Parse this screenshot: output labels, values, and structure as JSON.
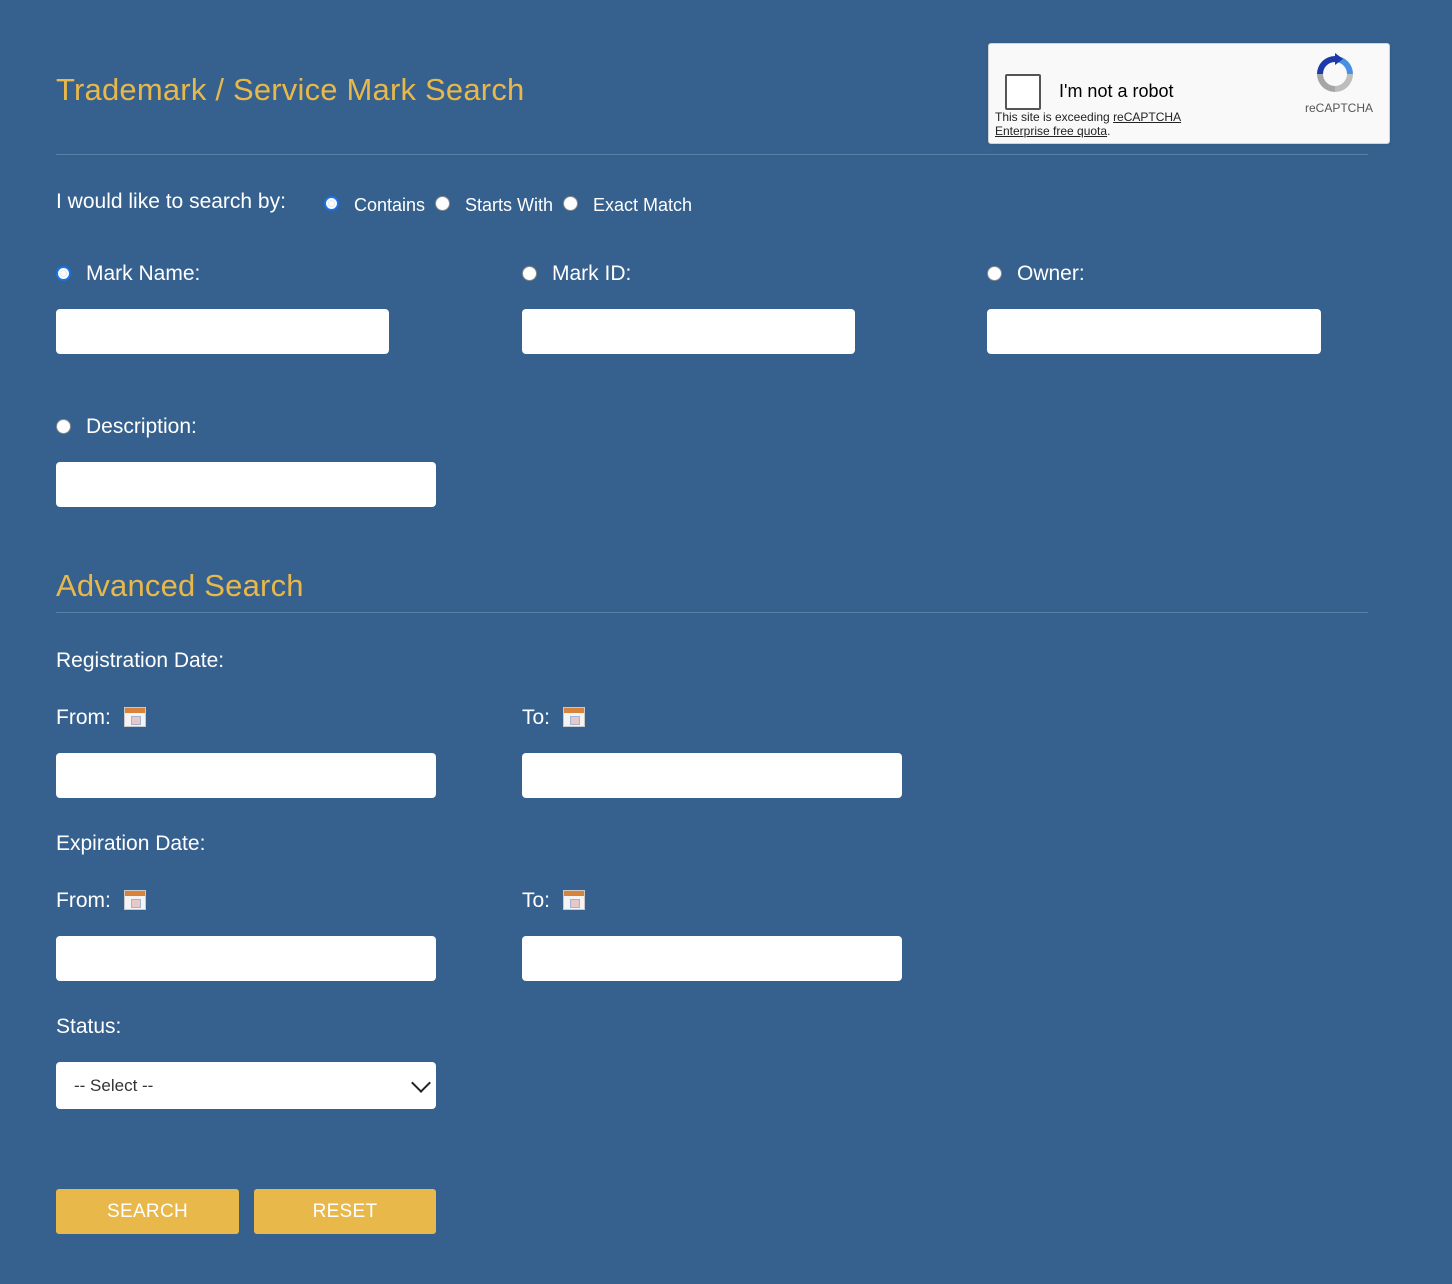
{
  "header": {
    "title": "Trademark / Service Mark Search"
  },
  "captcha": {
    "label": "I'm not a robot",
    "brand": "reCAPTCHA",
    "note_prefix": "This site is exceeding ",
    "note_link": "reCAPTCHA Enterprise free quota",
    "note_suffix": "."
  },
  "search_by": {
    "label": "I would like to search by:",
    "options": [
      "Contains",
      "Starts With",
      "Exact Match"
    ],
    "selected": "Contains"
  },
  "fields": {
    "mark_name": {
      "label": "Mark Name:",
      "value": ""
    },
    "mark_id": {
      "label": "Mark ID:",
      "value": ""
    },
    "owner": {
      "label": "Owner:",
      "value": ""
    },
    "description": {
      "label": "Description:",
      "value": ""
    },
    "selected_field": "Mark Name:"
  },
  "advanced": {
    "title": "Advanced Search",
    "registration": {
      "label": "Registration Date:",
      "from_label": "From:",
      "to_label": "To:",
      "from_value": "",
      "to_value": ""
    },
    "expiration": {
      "label": "Expiration Date:",
      "from_label": "From:",
      "to_label": "To:",
      "from_value": "",
      "to_value": ""
    },
    "status": {
      "label": "Status:",
      "selected": "-- Select --"
    }
  },
  "actions": {
    "search_label": "SEARCH",
    "reset_label": "RESET"
  },
  "colors": {
    "background": "#36618e",
    "accent": "#e8b84a",
    "text": "#ffffff"
  }
}
